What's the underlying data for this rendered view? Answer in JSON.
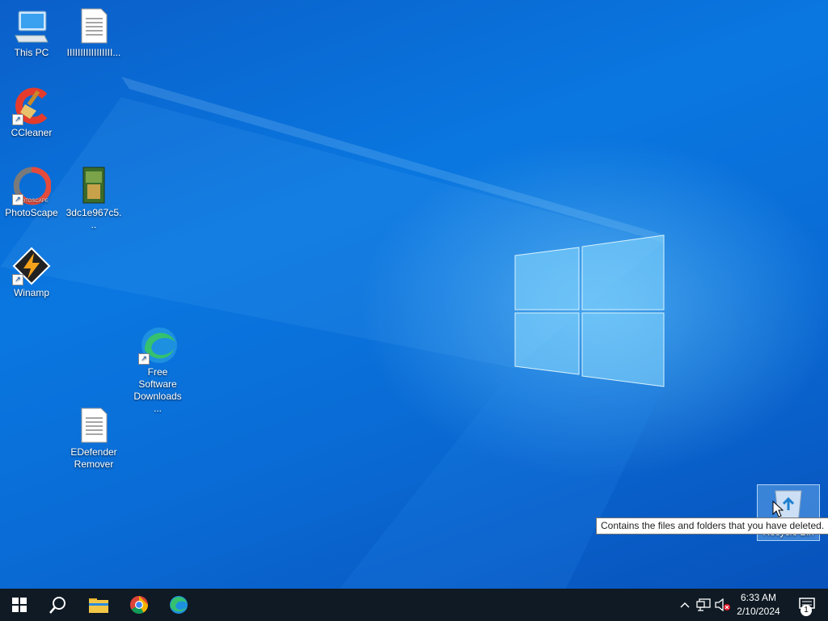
{
  "desktop": {
    "icons": [
      {
        "label": "This PC",
        "icon": "computer-icon"
      },
      {
        "label": "IIIIIIIIIIIIIIIII...",
        "icon": "text-file-icon"
      },
      {
        "label": "CCleaner",
        "icon": "ccleaner-icon"
      },
      {
        "label": "PhotoScape",
        "icon": "photoscape-icon"
      },
      {
        "label": "3dc1e967c5...",
        "icon": "game-cover-icon"
      },
      {
        "label": "Winamp",
        "icon": "winamp-icon"
      },
      {
        "label": "Free Software Downloads ...",
        "icon": "edge-icon"
      },
      {
        "label": "EDefender Remover",
        "icon": "text-file-icon"
      },
      {
        "label": "Recycle Bin",
        "icon": "recycle-bin-icon"
      }
    ],
    "tooltip": "Contains the files and folders that you have deleted."
  },
  "taskbar": {
    "pinned": [
      "start-icon",
      "search-icon",
      "file-explorer-icon",
      "chrome-icon",
      "edge-icon"
    ],
    "clock": {
      "time": "6:33 AM",
      "date": "2/10/2024"
    },
    "notification_count": "1"
  },
  "colors": {
    "accent": "#0a77e0",
    "taskbar": "#0f1a24"
  }
}
